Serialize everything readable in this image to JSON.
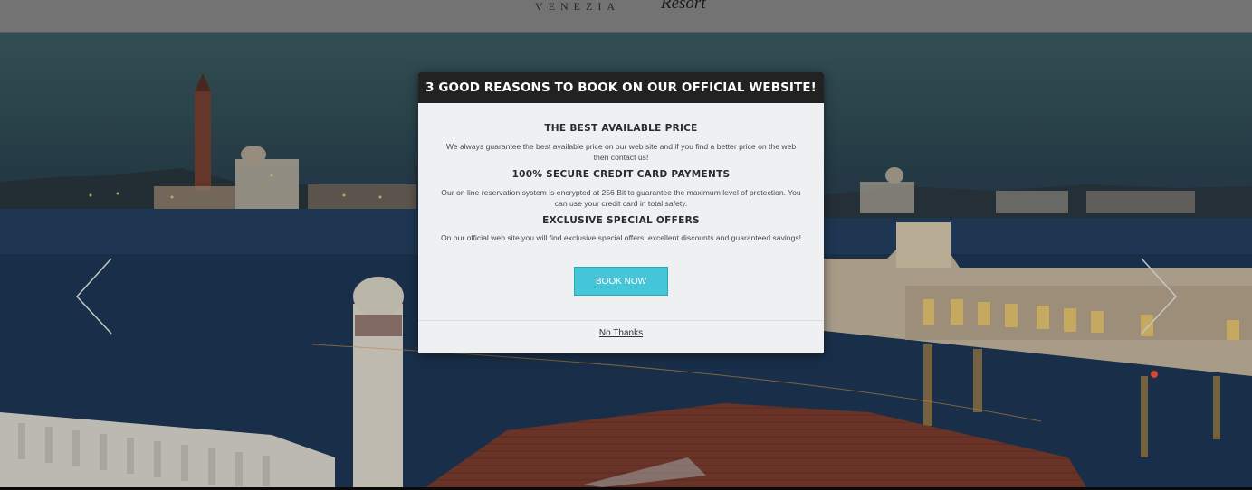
{
  "header": {
    "city": "VENEZIA",
    "brand_word": "Resort"
  },
  "hero": {
    "prev_arrow_icon": "chevron-left-icon",
    "next_arrow_icon": "chevron-right-icon"
  },
  "modal": {
    "title": "3 GOOD REASONS TO BOOK ON OUR OFFICIAL WEBSITE!",
    "reasons": [
      {
        "title": "THE BEST AVAILABLE PRICE",
        "text": "We always guarantee the best available price on our web site and if you find a better price on the web then contact us!"
      },
      {
        "title": "100% SECURE CREDIT CARD PAYMENTS",
        "text": "Our on line reservation system is encrypted at 256 Bit to guarantee the maximum level of protection. You can use your credit card in total safety."
      },
      {
        "title": "EXCLUSIVE SPECIAL OFFERS",
        "text": "On our official web site you will find exclusive special offers: excellent discounts and guaranteed savings!"
      }
    ],
    "book_label": "BOOK NOW",
    "dismiss_label": "No Thanks"
  },
  "colors": {
    "modal_header": "#222222",
    "modal_body": "#eef0f2",
    "button": "#45c6d8"
  }
}
